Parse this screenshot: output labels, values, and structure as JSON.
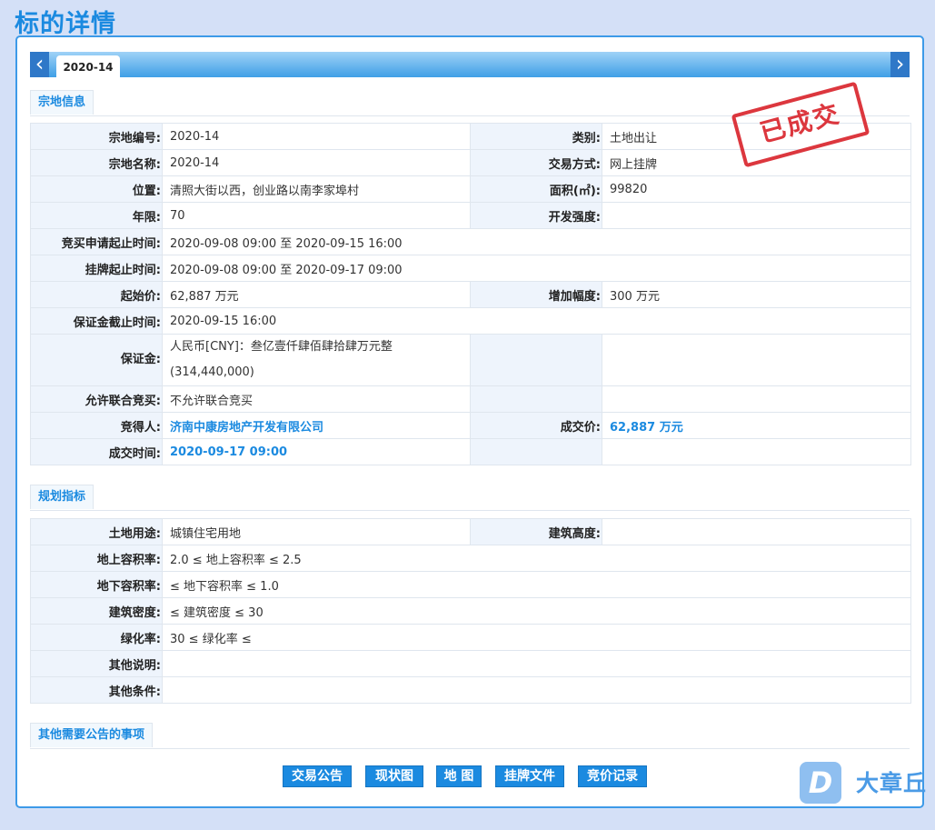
{
  "page": {
    "title": "标的详情"
  },
  "tabs": {
    "prev": "‹",
    "next": "›",
    "active": "2020-14"
  },
  "stamp": "已成交",
  "section1": {
    "title": "宗地信息",
    "parcel_no_label": "宗地编号:",
    "parcel_no": "2020-14",
    "category_label": "类别:",
    "category": "土地出让",
    "parcel_name_label": "宗地名称:",
    "parcel_name": "2020-14",
    "trade_method_label": "交易方式:",
    "trade_method": "网上挂牌",
    "location_label": "位置:",
    "location": "清照大街以西，创业路以南李家埠村",
    "area_label": "面积(㎡):",
    "area": "99820",
    "term_label": "年限:",
    "term": "70",
    "dev_intensity_label": "开发强度:",
    "dev_intensity": "",
    "bid_period_label": "竞买申请起止时间:",
    "bid_period": "2020-09-08 09:00 至 2020-09-15 16:00",
    "listing_period_label": "挂牌起止时间:",
    "listing_period": "2020-09-08 09:00 至 2020-09-17 09:00",
    "start_price_label": "起始价:",
    "start_price": "62,887 万元",
    "increment_label": "增加幅度:",
    "increment": "300 万元",
    "deposit_deadline_label": "保证金截止时间:",
    "deposit_deadline": "2020-09-15 16:00",
    "deposit_label": "保证金:",
    "deposit_line1": "人民币[CNY]：叁亿壹仟肆佰肆拾肆万元整",
    "deposit_line2": "(314,440,000)",
    "joint_bid_label": "允许联合竞买:",
    "joint_bid": "不允许联合竞买",
    "winner_label": "竞得人:",
    "winner": "济南中康房地产开发有限公司",
    "deal_price_label": "成交价:",
    "deal_price": "62,887 万元",
    "deal_time_label": "成交时间:",
    "deal_time": "2020-09-17 09:00"
  },
  "section2": {
    "title": "规划指标",
    "land_use_label": "土地用途:",
    "land_use": "城镇住宅用地",
    "building_height_label": "建筑高度:",
    "building_height": "",
    "far_above_label": "地上容积率:",
    "far_above": "2.0 ≤ 地上容积率 ≤ 2.5",
    "far_below_label": "地下容积率:",
    "far_below": "≤ 地下容积率 ≤ 1.0",
    "density_label": "建筑密度:",
    "density": "≤ 建筑密度 ≤ 30",
    "green_label": "绿化率:",
    "green": "30 ≤ 绿化率 ≤",
    "other_note_label": "其他说明:",
    "other_note": "",
    "other_cond_label": "其他条件:",
    "other_cond": ""
  },
  "section3": {
    "title": "其他需要公告的事项"
  },
  "buttons": {
    "announcement": "交易公告",
    "status_map": "现状图",
    "map": "地 图",
    "listing_docs": "挂牌文件",
    "bid_record": "竞价记录"
  },
  "brand": {
    "icon": "D",
    "name": "大章丘"
  }
}
